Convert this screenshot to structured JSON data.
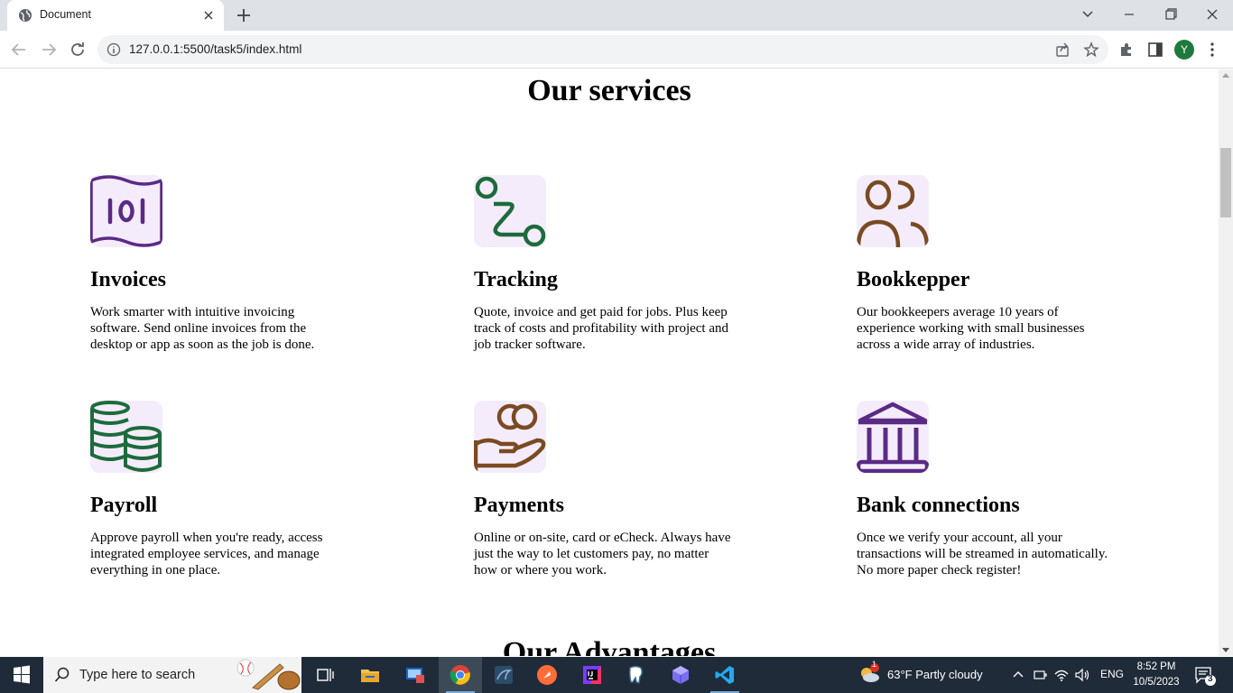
{
  "browser": {
    "tab_title": "Document",
    "url": "127.0.0.1:5500/task5/index.html",
    "profile_initial": "Y"
  },
  "page": {
    "services_title": "Our services",
    "advantages_title": "Our Advantages",
    "services": [
      {
        "title": "Invoices",
        "icon": "invoice-icon",
        "color": "#5b2a86",
        "text": "Work smarter with intuitive invoicing software. Send online invoices from the desktop or app as soon as the job is done."
      },
      {
        "title": "Tracking",
        "icon": "route-icon",
        "color": "#1d6b3c",
        "text": "Quote, invoice and get paid for jobs. Plus keep track of costs and profitability with project and job tracker software."
      },
      {
        "title": "Bookkepper",
        "icon": "users-icon",
        "color": "#7a4a22",
        "text": "Our bookkeepers average 10 years of experience working with small businesses across a wide array of industries."
      },
      {
        "title": "Payroll",
        "icon": "coins-stack-icon",
        "color": "#1d6b3c",
        "text": "Approve payroll when you're ready, access integrated employee services, and manage everything in one place."
      },
      {
        "title": "Payments",
        "icon": "hand-coins-icon",
        "color": "#7a4a22",
        "text": "Online or on-site, card or eCheck. Always have just the way to let customers pay, no matter how or where you work."
      },
      {
        "title": "Bank connections",
        "icon": "bank-icon",
        "color": "#5b2a86",
        "text": "Once we verify your account, all your transactions will be streamed in automatically. No more paper check register!"
      }
    ]
  },
  "taskbar": {
    "search_placeholder": "Type here to search",
    "weather": "63°F  Partly cloudy",
    "weather_badge": "1",
    "language": "ENG",
    "time": "8:52 PM",
    "date": "10/5/2023",
    "notification_count": "3"
  }
}
